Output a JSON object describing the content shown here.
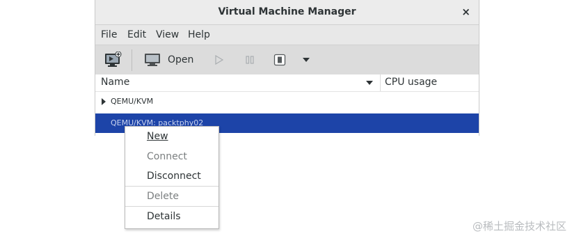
{
  "window": {
    "title": "Virtual Machine Manager",
    "close_glyph": "×"
  },
  "menubar": {
    "items": [
      "File",
      "Edit",
      "View",
      "Help"
    ]
  },
  "toolbar": {
    "open_label": "Open"
  },
  "header": {
    "name": "Name",
    "cpu": "CPU usage"
  },
  "rows": [
    {
      "label": "QEMU/KVM"
    },
    {
      "label": "QEMU/KVM: packtphy02"
    }
  ],
  "context_menu": {
    "items": [
      {
        "label": "New",
        "enabled": true
      },
      {
        "label": "Connect",
        "enabled": false
      },
      {
        "label": "Disconnect",
        "enabled": true
      },
      {
        "label": "Delete",
        "enabled": false
      },
      {
        "label": "Details",
        "enabled": true
      }
    ]
  },
  "watermark": "@稀土掘金技术社区",
  "colors": {
    "selection": "#1d44a8",
    "toolbar": "#dcdcdc",
    "menubar": "#e8e8e8"
  }
}
